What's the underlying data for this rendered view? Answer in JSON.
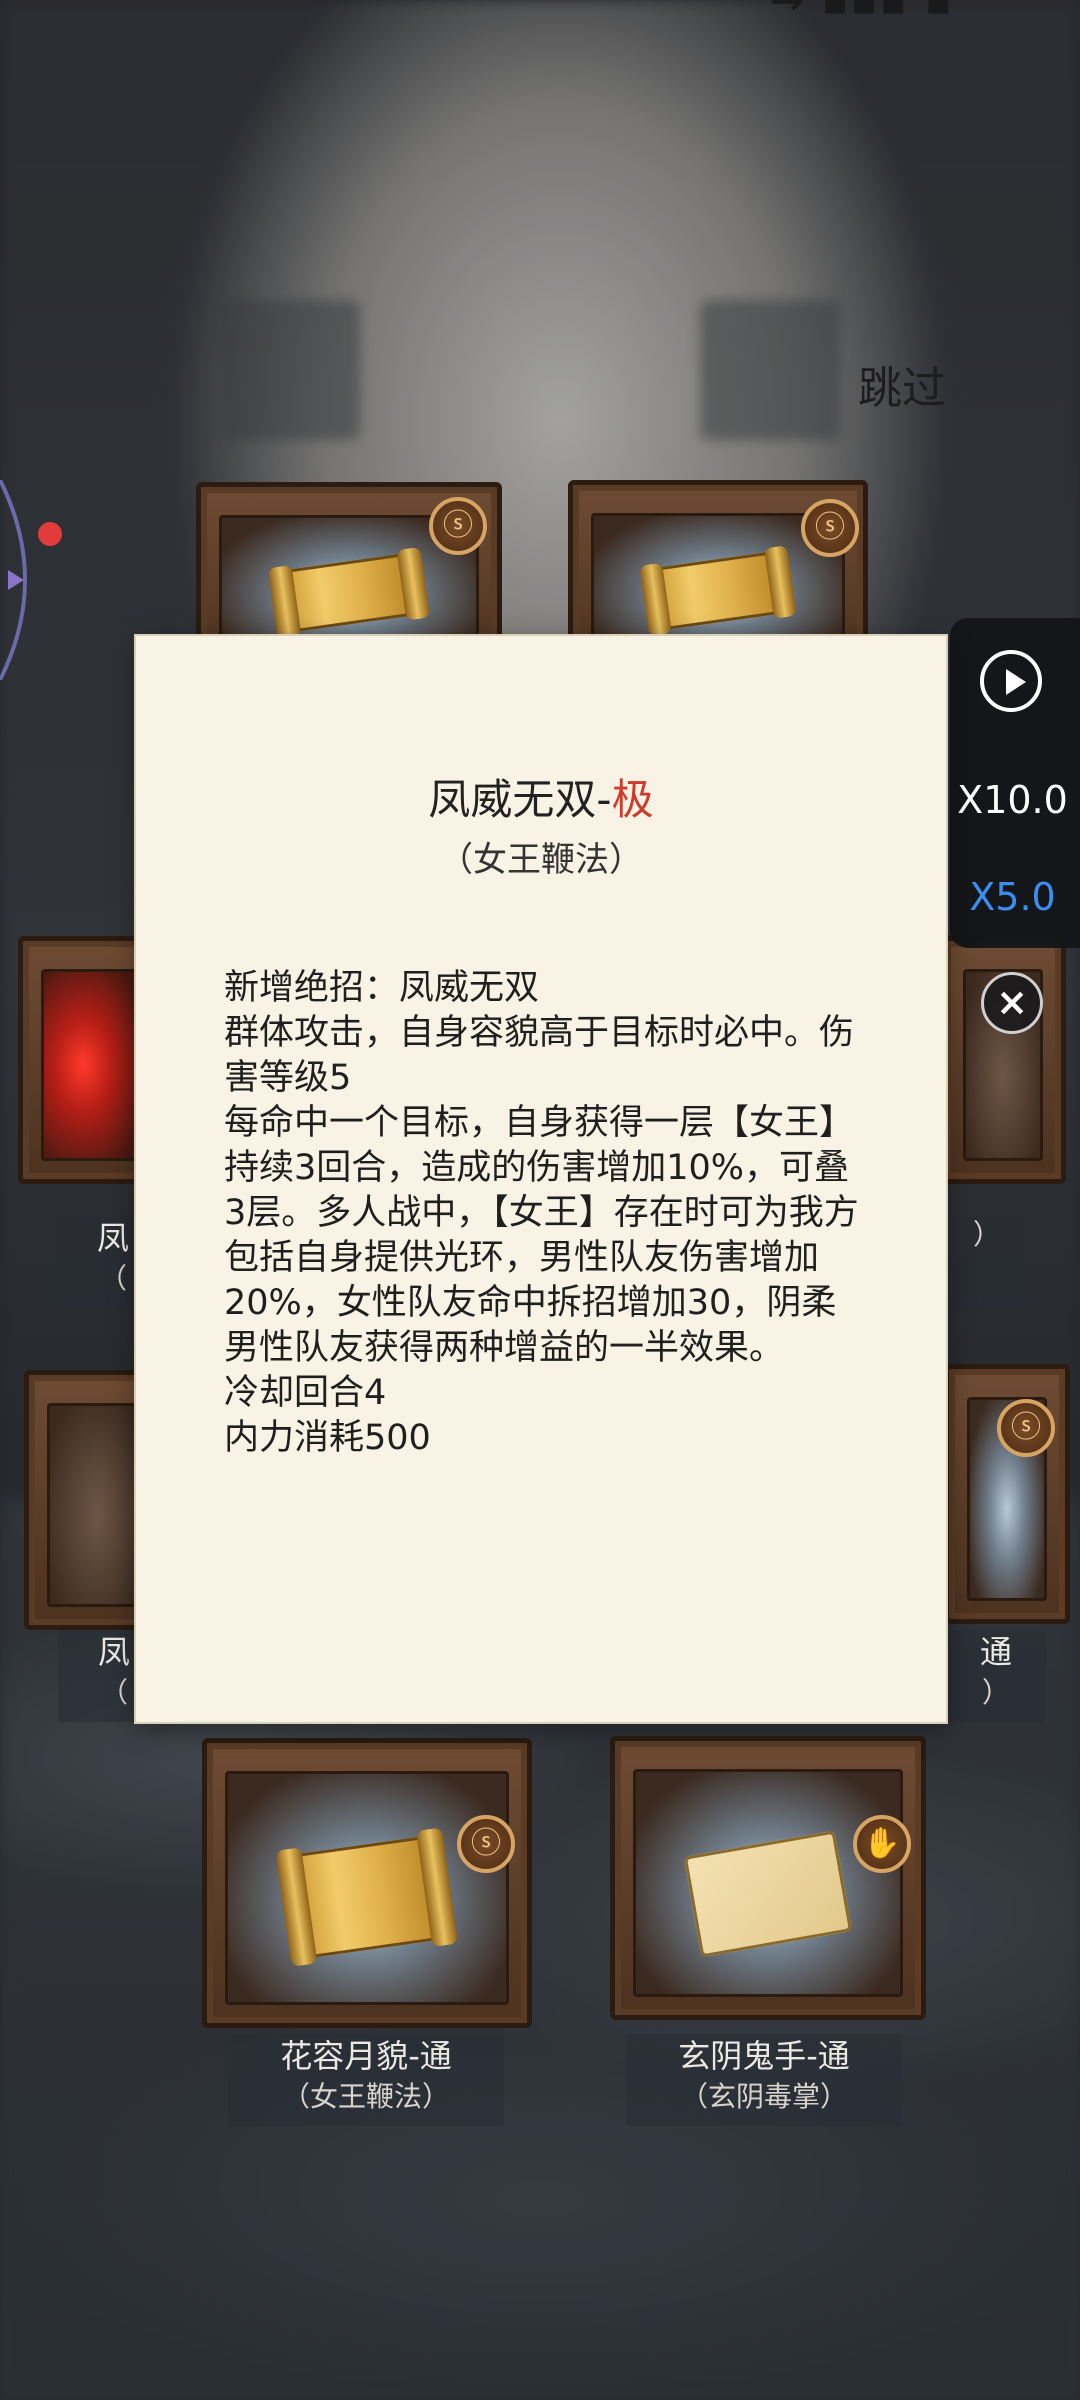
{
  "top_partial": "→ ▪▪▪ ▪",
  "skip_label": "跳过",
  "speed_panel": {
    "play_icon": "play-circle-icon",
    "options": [
      "X10.0",
      "X5.0"
    ],
    "selected": "X5.0"
  },
  "popup": {
    "title_main": "凤威无双-",
    "title_grade": "极",
    "subtitle": "（女王鞭法）",
    "description": "新增绝招：凤威无双\n群体攻击，自身容貌高于目标时必中。伤害等级5\n每命中一个目标，自身获得一层【女王】持续3回合，造成的伤害增加10%，可叠3层。多人战中，【女王】存在时可为我方包括自身提供光环，男性队友伤害增加20%，女性队友命中拆招增加30，阴柔男性队友获得两种增益的一半效果。\n冷却回合4\n内力消耗500"
  },
  "chests_visible": [
    {
      "name": "花容月貌-通",
      "school": "（女王鞭法）"
    },
    {
      "name": "玄阴鬼手-通",
      "school": "（玄阴毒掌）"
    }
  ],
  "partial_labels": {
    "left_row2_name": "凤",
    "left_row2_sub": "（",
    "right_row2_sub": "）",
    "left_row3_name": "凤",
    "left_row3_sub": "（",
    "right_row3_name": "通",
    "right_row3_sub": "）"
  }
}
